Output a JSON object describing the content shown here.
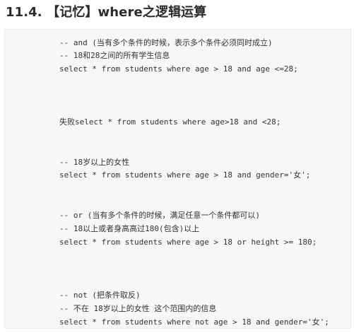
{
  "title": "11.4. 【记忆】where之逻辑运算",
  "code_lines": [
    "-- and (当有多个条件的时候，表示多个条件必须同时成立)",
    "-- 18和28之间的所有学生信息",
    "select * from students where age > 18 and age <=28;",
    "失败select * from students where age>18 and <28;",
    "-- 18岁以上的女性",
    "select * from students where age > 18 and gender='女';",
    "-- or (当有多个条件的时候，满足任意一个条件都可以)",
    "-- 18以上或者身高高过180(包含)以上",
    "select * from students where age > 18 or height >= 180;",
    "-- not (把条件取反)",
    "-- 不在 18岁以上的女性 这个范围内的信息",
    "select * from students where not age > 18 and gender='女';"
  ]
}
